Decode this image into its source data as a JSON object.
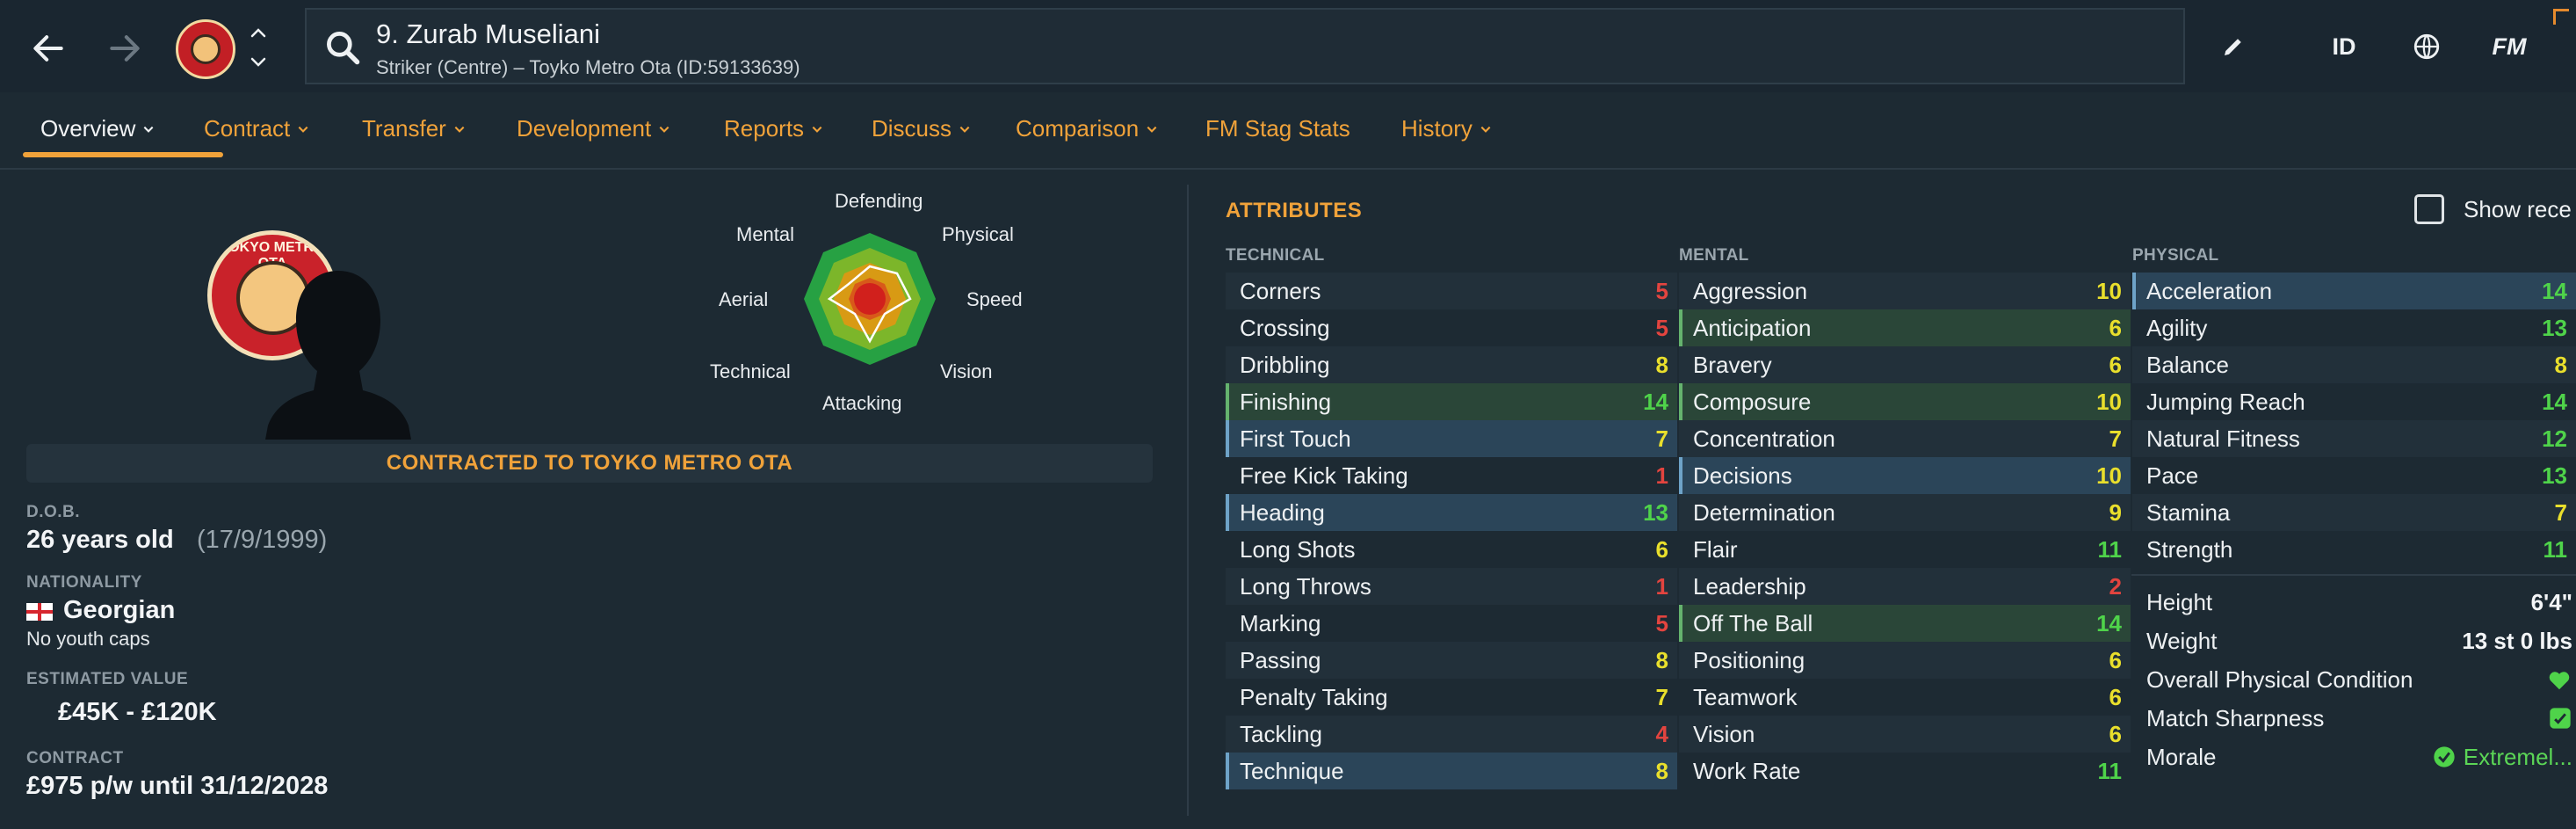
{
  "header": {
    "player_title": "9. Zurab Museliani",
    "player_subtitle": "Striker (Centre) – Toyko Metro Ota (ID:59133639)",
    "id_label": "ID",
    "fm_label": "FM"
  },
  "tabs": [
    {
      "label": "Overview"
    },
    {
      "label": "Contract"
    },
    {
      "label": "Transfer"
    },
    {
      "label": "Development"
    },
    {
      "label": "Reports"
    },
    {
      "label": "Discuss"
    },
    {
      "label": "Comparison"
    },
    {
      "label": "FM Stag Stats"
    },
    {
      "label": "History"
    }
  ],
  "overview": {
    "badge_text": "TOKYO METRO OTA",
    "radar_labels": {
      "defending": "Defending",
      "physical": "Physical",
      "speed": "Speed",
      "vision": "Vision",
      "attacking": "Attacking",
      "technical": "Technical",
      "aerial": "Aerial",
      "mental": "Mental"
    },
    "contract_banner": "CONTRACTED TO TOYKO METRO OTA",
    "dob_label": "D.O.B.",
    "age": "26 years old",
    "dob": "(17/9/1999)",
    "nationality_label": "NATIONALITY",
    "nationality": "Georgian",
    "youth_caps": "No youth caps",
    "value_label": "ESTIMATED VALUE",
    "value": "£45K - £120K",
    "contract_label": "CONTRACT",
    "contract": "£975 p/w until 31/12/2028"
  },
  "attributes": {
    "title": "ATTRIBUTES",
    "show_recent": "Show rece",
    "technical_header": "TECHNICAL",
    "mental_header": "MENTAL",
    "physical_header": "PHYSICAL",
    "technical": [
      {
        "name": "Corners",
        "value": "5"
      },
      {
        "name": "Crossing",
        "value": "5"
      },
      {
        "name": "Dribbling",
        "value": "8"
      },
      {
        "name": "Finishing",
        "value": "14"
      },
      {
        "name": "First Touch",
        "value": "7"
      },
      {
        "name": "Free Kick Taking",
        "value": "1"
      },
      {
        "name": "Heading",
        "value": "13"
      },
      {
        "name": "Long Shots",
        "value": "6"
      },
      {
        "name": "Long Throws",
        "value": "1"
      },
      {
        "name": "Marking",
        "value": "5"
      },
      {
        "name": "Passing",
        "value": "8"
      },
      {
        "name": "Penalty Taking",
        "value": "7"
      },
      {
        "name": "Tackling",
        "value": "4"
      },
      {
        "name": "Technique",
        "value": "8"
      }
    ],
    "mental": [
      {
        "name": "Aggression",
        "value": "10"
      },
      {
        "name": "Anticipation",
        "value": "6"
      },
      {
        "name": "Bravery",
        "value": "6"
      },
      {
        "name": "Composure",
        "value": "10"
      },
      {
        "name": "Concentration",
        "value": "7"
      },
      {
        "name": "Decisions",
        "value": "10"
      },
      {
        "name": "Determination",
        "value": "9"
      },
      {
        "name": "Flair",
        "value": "11"
      },
      {
        "name": "Leadership",
        "value": "2"
      },
      {
        "name": "Off The Ball",
        "value": "14"
      },
      {
        "name": "Positioning",
        "value": "6"
      },
      {
        "name": "Teamwork",
        "value": "6"
      },
      {
        "name": "Vision",
        "value": "6"
      },
      {
        "name": "Work Rate",
        "value": "11"
      }
    ],
    "physical": [
      {
        "name": "Acceleration",
        "value": "14"
      },
      {
        "name": "Agility",
        "value": "13"
      },
      {
        "name": "Balance",
        "value": "8"
      },
      {
        "name": "Jumping Reach",
        "value": "14"
      },
      {
        "name": "Natural Fitness",
        "value": "12"
      },
      {
        "name": "Pace",
        "value": "13"
      },
      {
        "name": "Stamina",
        "value": "7"
      },
      {
        "name": "Strength",
        "value": "11"
      }
    ],
    "height_label": "Height",
    "height": "6'4\"",
    "weight_label": "Weight",
    "weight": "13 st 0 lbs",
    "condition_label": "Overall Physical Condition",
    "sharpness_label": "Match Sharpness",
    "morale_label": "Morale",
    "morale": "Extremel..."
  },
  "colors": {
    "accent": "#f0a23a",
    "background": "#1d2a33",
    "attr_low": "#e3443f",
    "attr_mid": "#e9df2c",
    "attr_high": "#4fd34a"
  }
}
